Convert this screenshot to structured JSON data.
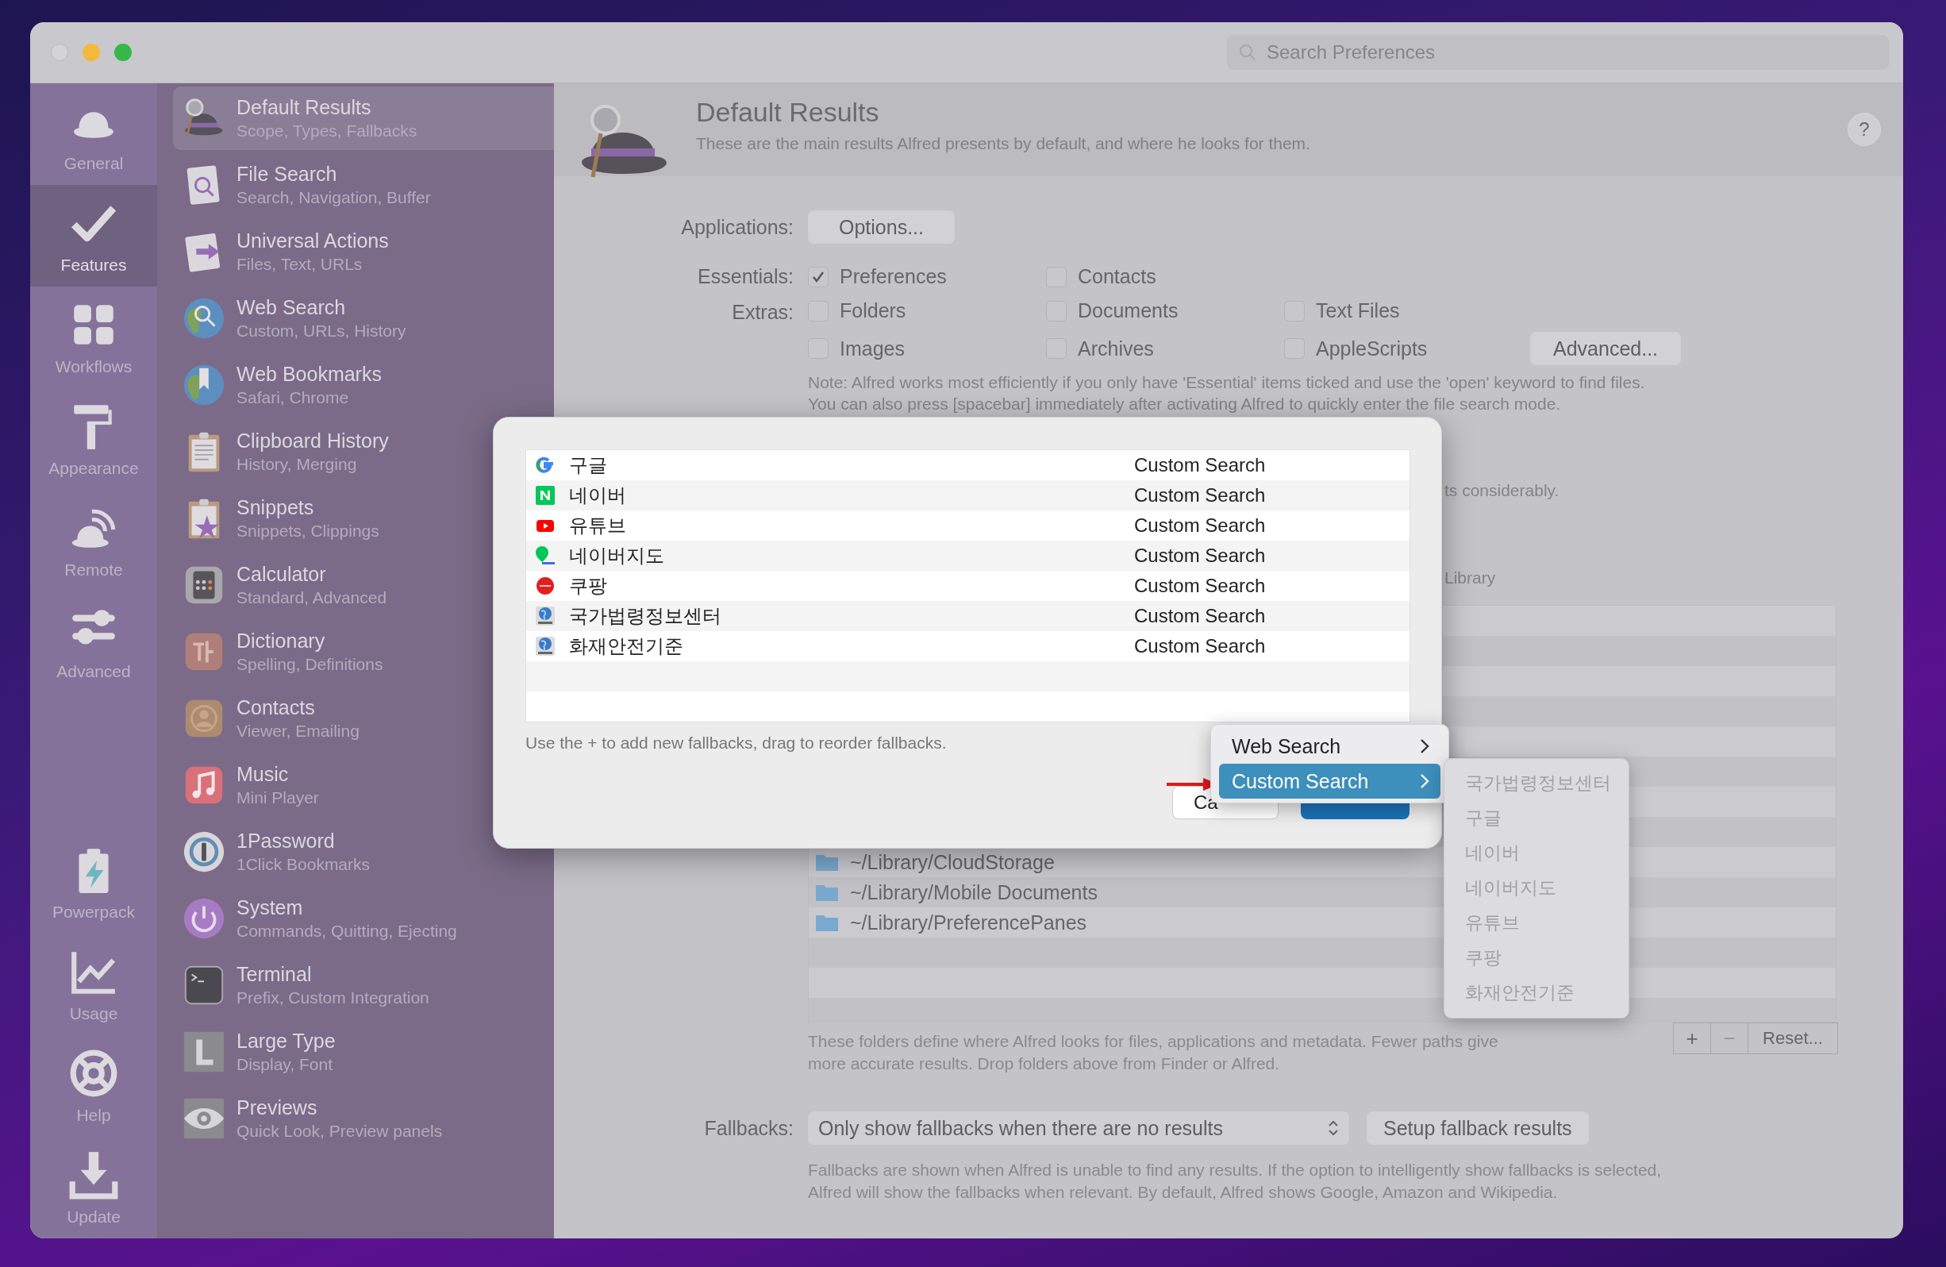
{
  "window": {
    "search": {
      "placeholder": "Search Preferences"
    }
  },
  "rail": [
    {
      "label": "General",
      "selected": false
    },
    {
      "label": "Features",
      "selected": true
    },
    {
      "label": "Workflows",
      "selected": false
    },
    {
      "label": "Appearance",
      "selected": false
    },
    {
      "label": "Remote",
      "selected": false
    },
    {
      "label": "Advanced",
      "selected": false
    },
    {
      "label": "Powerpack",
      "selected": false
    },
    {
      "label": "Usage",
      "selected": false
    },
    {
      "label": "Help",
      "selected": false
    },
    {
      "label": "Update",
      "selected": false
    }
  ],
  "features": [
    {
      "title": "Default Results",
      "subtitle": "Scope, Types, Fallbacks",
      "selected": true
    },
    {
      "title": "File Search",
      "subtitle": "Search, Navigation, Buffer",
      "selected": false
    },
    {
      "title": "Universal Actions",
      "subtitle": "Files, Text, URLs",
      "selected": false
    },
    {
      "title": "Web Search",
      "subtitle": "Custom, URLs, History",
      "selected": false
    },
    {
      "title": "Web Bookmarks",
      "subtitle": "Safari, Chrome",
      "selected": false
    },
    {
      "title": "Clipboard History",
      "subtitle": "History, Merging",
      "selected": false
    },
    {
      "title": "Snippets",
      "subtitle": "Snippets, Clippings",
      "selected": false
    },
    {
      "title": "Calculator",
      "subtitle": "Standard, Advanced",
      "selected": false
    },
    {
      "title": "Dictionary",
      "subtitle": "Spelling, Definitions",
      "selected": false
    },
    {
      "title": "Contacts",
      "subtitle": "Viewer, Emailing",
      "selected": false
    },
    {
      "title": "Music",
      "subtitle": "Mini Player",
      "selected": false
    },
    {
      "title": "1Password",
      "subtitle": "1Click Bookmarks",
      "selected": false
    },
    {
      "title": "System",
      "subtitle": "Commands, Quitting, Ejecting",
      "selected": false
    },
    {
      "title": "Terminal",
      "subtitle": "Prefix, Custom Integration",
      "selected": false
    },
    {
      "title": "Large Type",
      "subtitle": "Display, Font",
      "selected": false
    },
    {
      "title": "Previews",
      "subtitle": "Quick Look, Preview panels",
      "selected": false
    }
  ],
  "header": {
    "title": "Default Results",
    "subtitle": "These are the main results Alfred presents by default, and where he looks for them.",
    "help": "?"
  },
  "applications": {
    "label": "Applications:",
    "button": "Options..."
  },
  "essentials": {
    "label": "Essentials:",
    "items": [
      {
        "label": "Preferences",
        "checked": true
      },
      {
        "label": "Contacts",
        "checked": false
      }
    ]
  },
  "extras": {
    "label": "Extras:",
    "items": [
      {
        "label": "Folders",
        "checked": false
      },
      {
        "label": "Documents",
        "checked": false
      },
      {
        "label": "Text Files",
        "checked": false
      },
      {
        "label": "Images",
        "checked": false
      },
      {
        "label": "Archives",
        "checked": false
      },
      {
        "label": "AppleScripts",
        "checked": false
      }
    ],
    "button": "Advanced..."
  },
  "note": "Note: Alfred works most efficiently if you only have 'Essential' items ticked and use the 'open' keyword to find files.\nYou can also press [spacebar] immediately after activating Alfred to quickly enter the file search mode.",
  "obscured_line_1": "ts considerably.",
  "obscured_line_2": "Library",
  "search_scope": {
    "folders": [
      "~/Library/CloudStorage",
      "~/Library/Mobile Documents",
      "~/Library/PreferencePanes"
    ],
    "buttons": [
      {
        "label": "+",
        "disabled": false
      },
      {
        "label": "−",
        "disabled": true
      },
      {
        "label": "Reset...",
        "disabled": false
      }
    ],
    "description": "These folders define where Alfred looks for files, applications and metadata. Fewer paths give\nmore accurate results. Drop folders above from Finder or Alfred."
  },
  "fallbacks": {
    "label": "Fallbacks:",
    "select": "Only show fallbacks when there are no results",
    "button": "Setup fallback results",
    "description": "Fallbacks are shown when Alfred is unable to find any results. If the option to intelligently show fallbacks is selected,\nAlfred will show the fallbacks when relevant. By default, Alfred shows Google, Amazon and Wikipedia."
  },
  "dialog": {
    "rows": [
      {
        "name": "구글",
        "type": "Custom Search"
      },
      {
        "name": "네이버",
        "type": "Custom Search"
      },
      {
        "name": "유튜브",
        "type": "Custom Search"
      },
      {
        "name": "네이버지도",
        "type": "Custom Search"
      },
      {
        "name": "쿠팡",
        "type": "Custom Search"
      },
      {
        "name": "국가법령정보센터",
        "type": "Custom Search"
      },
      {
        "name": "화재안전기준",
        "type": "Custom Search"
      }
    ],
    "hint": "Use the + to add new fallbacks, drag to reorder fallbacks.",
    "cancel": "Ca"
  },
  "context_menu": {
    "items": [
      {
        "label": "Web Search",
        "selected": false
      },
      {
        "label": "Custom Search",
        "selected": true
      }
    ]
  },
  "submenu": {
    "items": [
      {
        "label": "국가법령정보센터",
        "disabled": true
      },
      {
        "label": "구글",
        "disabled": true
      },
      {
        "label": "네이버",
        "disabled": true
      },
      {
        "label": "네이버지도",
        "disabled": true
      },
      {
        "label": "유튜브",
        "disabled": true
      },
      {
        "label": "쿠팡",
        "disabled": true
      },
      {
        "label": "화재안전기준",
        "disabled": true
      }
    ]
  }
}
